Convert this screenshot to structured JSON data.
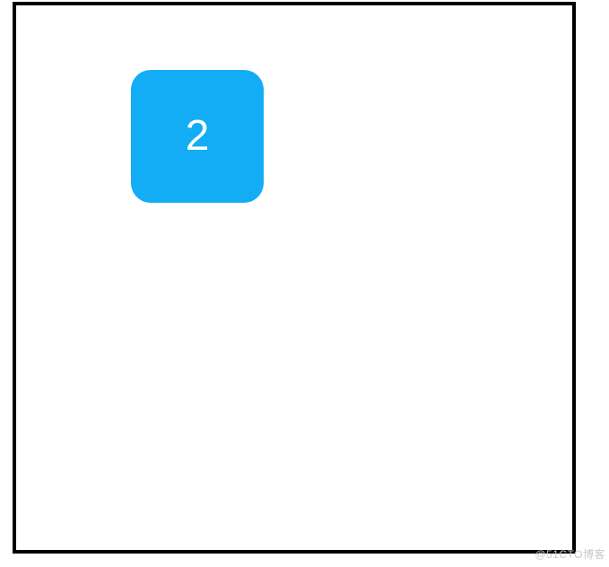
{
  "tile": {
    "number": "2",
    "color": "#12adf5",
    "text_color": "#ffffff"
  },
  "watermark": "@51CTO博客"
}
